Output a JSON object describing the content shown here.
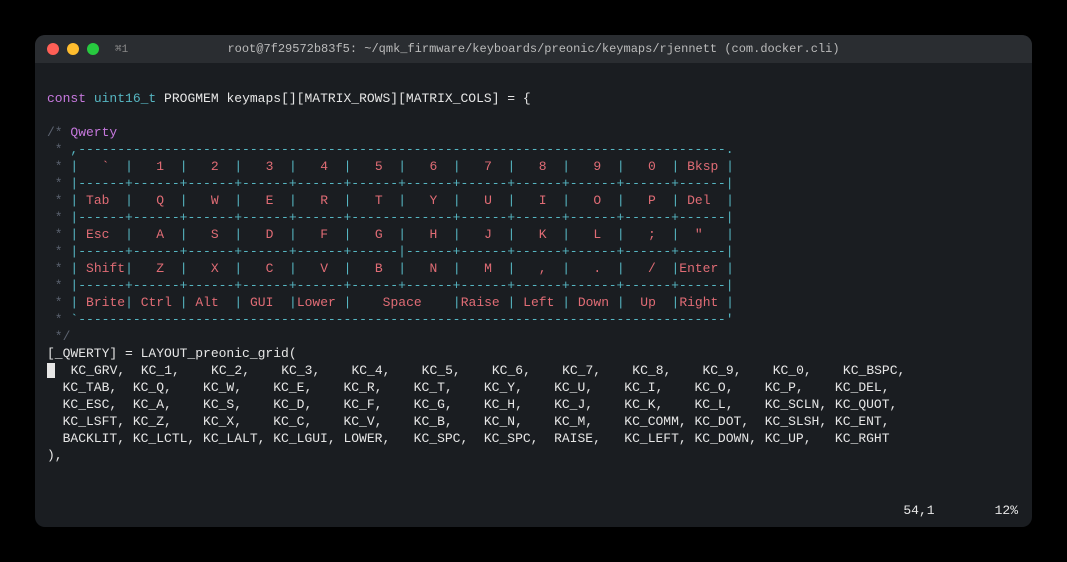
{
  "titlebar": {
    "icon": "⌘1",
    "title": "root@7f29572b83f5: ~/qmk_firmware/keyboards/preonic/keymaps/rjennett (com.docker.cli)"
  },
  "code": {
    "decl_const": "const",
    "decl_type": "uint16_t",
    "decl_rest": " PROGMEM keymaps[][MATRIX_ROWS][MATRIX_COLS] = {",
    "comment_open": "/* ",
    "comment_name": "Qwerty",
    "border_top": " * ,-----------------------------------------------------------------------------------.",
    "row1": " * |   `  |   1  |   2  |   3  |   4  |   5  |   6  |   7  |   8  |   9  |   0  | Bksp |",
    "sep1": " * |------+------+------+------+------+------+------+------+------+------+------+------|",
    "row2": " * | Tab  |   Q  |   W  |   E  |   R  |   T  |   Y  |   U  |   I  |   O  |   P  | Del  |",
    "sep2": " * |------+------+------+------+------+-------------+------+------+------+------+------|",
    "row3": " * | Esc  |   A  |   S  |   D  |   F  |   G  |   H  |   J  |   K  |   L  |   ;  |  \"   |",
    "sep3": " * |------+------+------+------+------+------|------+------+------+------+------+------|",
    "row4": " * | Shift|   Z  |   X  |   C  |   V  |   B  |   N  |   M  |   ,  |   .  |   /  |Enter |",
    "sep4": " * |------+------+------+------+------+------+------+------+------+------+------+------|",
    "row5": " * | Brite| Ctrl | Alt  | GUI  |Lower |    Space    |Raise | Left | Down |  Up  |Right |",
    "border_bot": " * `-----------------------------------------------------------------------------------'",
    "comment_close": " */",
    "layout_line": "[_QWERTY] = LAYOUT_preonic_grid(",
    "kc1": "  KC_GRV,  KC_1,    KC_2,    KC_3,    KC_4,    KC_5,    KC_6,    KC_7,    KC_8,    KC_9,    KC_0,    KC_BSPC,",
    "kc2": "  KC_TAB,  KC_Q,    KC_W,    KC_E,    KC_R,    KC_T,    KC_Y,    KC_U,    KC_I,    KC_O,    KC_P,    KC_DEL,",
    "kc3": "  KC_ESC,  KC_A,    KC_S,    KC_D,    KC_F,    KC_G,    KC_H,    KC_J,    KC_K,    KC_L,    KC_SCLN, KC_QUOT,",
    "kc4": "  KC_LSFT, KC_Z,    KC_X,    KC_C,    KC_V,    KC_B,    KC_N,    KC_M,    KC_COMM, KC_DOT,  KC_SLSH, KC_ENT,",
    "kc5": "  BACKLIT, KC_LCTL, KC_LALT, KC_LGUI, LOWER,   KC_SPC,  KC_SPC,  RAISE,   KC_LEFT, KC_DOWN, KC_UP,   KC_RGHT",
    "close_paren": "),"
  },
  "status": {
    "pos": "54,1",
    "pct": "12%"
  }
}
